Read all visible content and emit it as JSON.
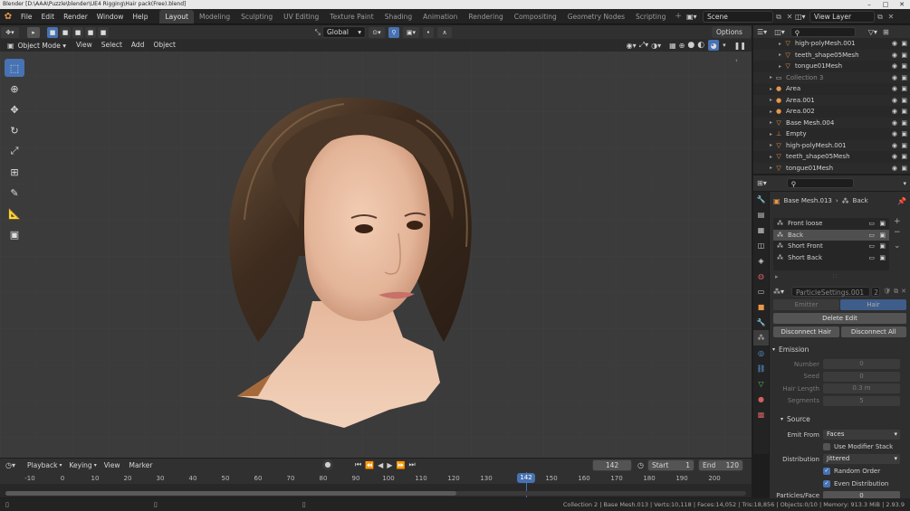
{
  "window": {
    "title": "Blender [D:\\AAA\\Puzzle\\blender\\UE4 Rigging\\Hair pack(Free).blend]"
  },
  "menu": [
    "File",
    "Edit",
    "Render",
    "Window",
    "Help"
  ],
  "workspaces": [
    {
      "label": "Layout",
      "active": true
    },
    {
      "label": "Modeling"
    },
    {
      "label": "Sculpting"
    },
    {
      "label": "UV Editing"
    },
    {
      "label": "Texture Paint"
    },
    {
      "label": "Shading"
    },
    {
      "label": "Animation"
    },
    {
      "label": "Rendering"
    },
    {
      "label": "Compositing"
    },
    {
      "label": "Geometry Nodes"
    },
    {
      "label": "Scripting"
    }
  ],
  "scene": {
    "name": "Scene",
    "view_layer": "View Layer"
  },
  "viewport_header": {
    "transform": "Global",
    "options": "Options"
  },
  "viewport_header2": {
    "mode": "Object Mode",
    "menus": [
      "View",
      "Select",
      "Add",
      "Object"
    ]
  },
  "outliner": {
    "rows": [
      {
        "label": "high-polyMesh.001",
        "icon": "mesh-icon",
        "indent": 2
      },
      {
        "label": "teeth_shape05Mesh",
        "icon": "mesh-icon",
        "indent": 2
      },
      {
        "label": "tongue01Mesh",
        "icon": "mesh-icon",
        "indent": 2
      },
      {
        "label": "Collection 3",
        "icon": "collection-icon",
        "indent": 1,
        "dim": true
      },
      {
        "label": "Area",
        "icon": "light-icon",
        "indent": 1
      },
      {
        "label": "Area.001",
        "icon": "light-icon",
        "indent": 1
      },
      {
        "label": "Area.002",
        "icon": "light-icon",
        "indent": 1
      },
      {
        "label": "Base Mesh.004",
        "icon": "mesh-icon",
        "indent": 1
      },
      {
        "label": "Empty",
        "icon": "empty-icon",
        "indent": 1
      },
      {
        "label": "high-polyMesh.001",
        "icon": "mesh-icon",
        "indent": 1
      },
      {
        "label": "teeth_shape05Mesh",
        "icon": "mesh-icon",
        "indent": 1
      },
      {
        "label": "tongue01Mesh",
        "icon": "mesh-icon",
        "indent": 1
      }
    ]
  },
  "properties": {
    "object_name": "Base Mesh.013",
    "system_name": "Back",
    "particle_systems": [
      {
        "label": "Front loose"
      },
      {
        "label": "Back",
        "selected": true
      },
      {
        "label": "Short Front"
      },
      {
        "label": "Short Back"
      }
    ],
    "settings_name": "ParticleSettings.001",
    "settings_users": "2",
    "type_emitter": "Emitter",
    "type_hair": "Hair",
    "delete_edit": "Delete Edit",
    "disconnect_hair": "Disconnect Hair",
    "disconnect_all": "Disconnect All",
    "emission_title": "Emission",
    "emission": [
      {
        "label": "Number",
        "value": "0"
      },
      {
        "label": "Seed",
        "value": "0"
      },
      {
        "label": "Hair Length",
        "value": "0.3 m"
      },
      {
        "label": "Segments",
        "value": "5"
      }
    ],
    "source_title": "Source",
    "emit_from_label": "Emit From",
    "emit_from": "Faces",
    "use_modifier_stack": "Use Modifier Stack",
    "distribution_label": "Distribution",
    "distribution": "Jittered",
    "random_order": "Random Order",
    "even_distribution": "Even Distribution",
    "particles_face_label": "Particles/Face",
    "particles_face": "0"
  },
  "timeline": {
    "menus": [
      "Playback",
      "Keying",
      "View",
      "Marker"
    ],
    "current_frame": "142",
    "start_label": "Start",
    "start": "1",
    "end_label": "End",
    "end": "120",
    "ticks": [
      "-10",
      "0",
      "10",
      "20",
      "30",
      "40",
      "50",
      "60",
      "70",
      "80",
      "90",
      "100",
      "110",
      "120",
      "130",
      "150",
      "160",
      "170",
      "180",
      "190",
      "200"
    ],
    "playhead_label": "142"
  },
  "status": {
    "text": "Collection 2 | Base Mesh.013 | Verts:10,118 | Faces:14,052 | Tris:18,856 | Objects:0/10 | Memory: 913.3 MiB | 2.93.9"
  },
  "colors": {
    "accent": "#4772b3",
    "orange_icon": "#e8974a",
    "green_icon": "#5fbf6a"
  }
}
